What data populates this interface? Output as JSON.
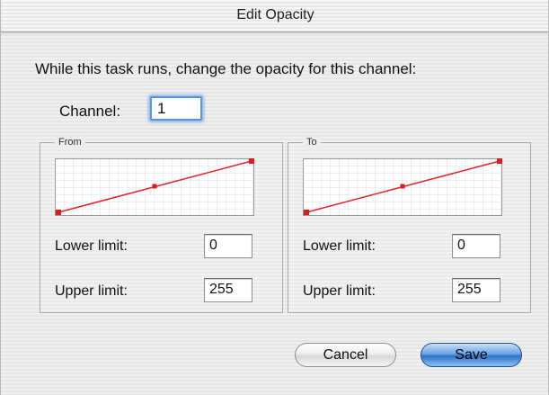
{
  "window": {
    "title": "Edit Opacity"
  },
  "instruction": "While this task runs, change the opacity for this channel:",
  "channel": {
    "label": "Channel:",
    "value": "1"
  },
  "groups": {
    "from": {
      "title": "From",
      "lower_label": "Lower limit:",
      "lower_value": "0",
      "upper_label": "Upper limit:",
      "upper_value": "255"
    },
    "to": {
      "title": "To",
      "lower_label": "Lower limit:",
      "lower_value": "0",
      "upper_label": "Upper limit:",
      "upper_value": "255"
    }
  },
  "buttons": {
    "cancel": "Cancel",
    "save": "Save"
  },
  "colors": {
    "curve": "#e0242c",
    "default_button": "#3a7fd5",
    "focus_ring": "#6ea0e1"
  }
}
